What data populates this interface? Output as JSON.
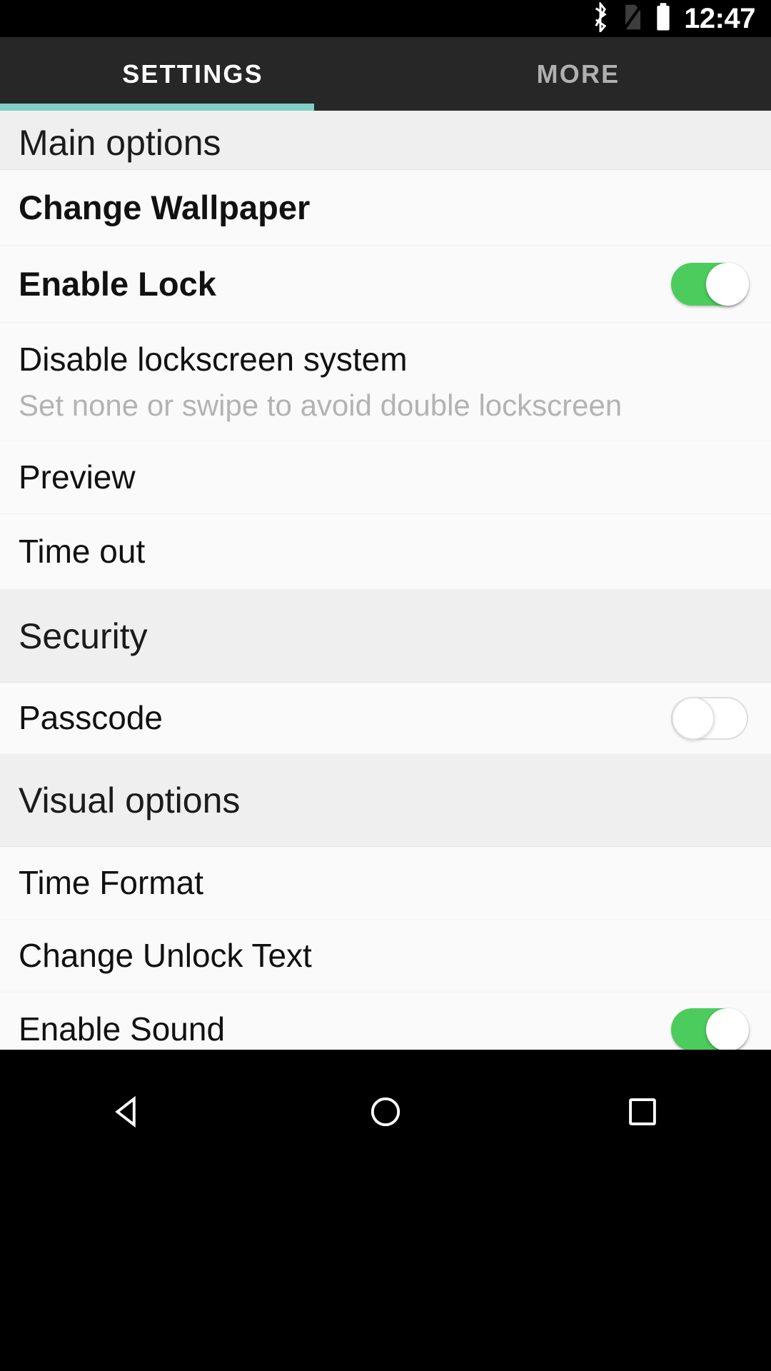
{
  "statusbar": {
    "time": "12:47",
    "icons": [
      {
        "name": "bluetooth-icon"
      },
      {
        "name": "no-sim-icon"
      },
      {
        "name": "battery-full-icon"
      }
    ]
  },
  "tabs": [
    {
      "label": "SETTINGS",
      "active": true
    },
    {
      "label": "MORE",
      "active": false
    }
  ],
  "theme": {
    "accent": "#7fcfc4",
    "toggle_on": "#4ccc5d",
    "statusbar_bg": "#000000",
    "tabbar_bg": "#272727",
    "section_bg": "#efefef",
    "row_bg": "#fafafa",
    "subtitle_color": "#b3b3b3"
  },
  "sections": [
    {
      "header": "Main options",
      "rows": [
        {
          "title": "Change Wallpaper",
          "bold": true,
          "subtitle": null,
          "toggle": null
        },
        {
          "title": "Enable Lock",
          "bold": true,
          "subtitle": null,
          "toggle": "on"
        },
        {
          "title": "Disable lockscreen system",
          "bold": false,
          "subtitle": "Set none or swipe to avoid double lockscreen",
          "toggle": null
        },
        {
          "title": "Preview",
          "bold": false,
          "subtitle": null,
          "toggle": null
        },
        {
          "title": "Time out",
          "bold": false,
          "subtitle": null,
          "toggle": null
        }
      ]
    },
    {
      "header": "Security",
      "rows": [
        {
          "title": "Passcode",
          "bold": false,
          "subtitle": null,
          "toggle": "off"
        }
      ]
    },
    {
      "header": "Visual options",
      "rows": [
        {
          "title": "Time Format",
          "bold": false,
          "subtitle": null,
          "toggle": null
        },
        {
          "title": "Change Unlock Text",
          "bold": false,
          "subtitle": null,
          "toggle": null
        },
        {
          "title": "Enable Sound",
          "bold": false,
          "subtitle": null,
          "toggle": "on"
        }
      ]
    }
  ],
  "navbar": {
    "back_label": "back-button",
    "home_label": "home-button",
    "recents_label": "recents-button"
  }
}
